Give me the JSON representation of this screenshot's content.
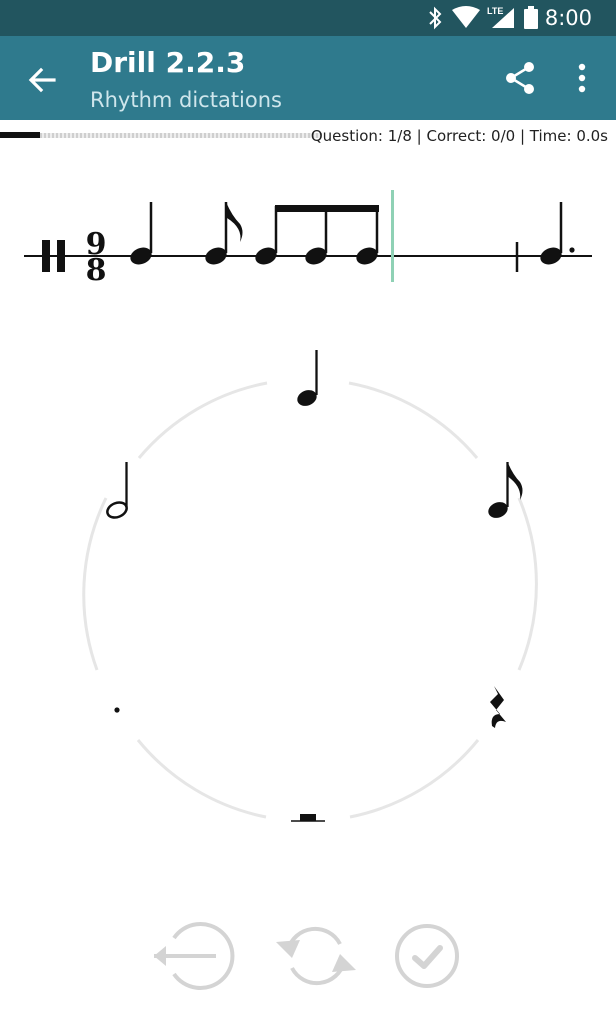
{
  "status_bar": {
    "time": "8:00",
    "network": "LTE",
    "icons": [
      "bluetooth-icon",
      "wifi-icon",
      "signal-icon",
      "battery-icon"
    ]
  },
  "app_bar": {
    "title": "Drill 2.2.3",
    "subtitle": "Rhythm dictations",
    "actions": [
      "share-icon",
      "more-vert-icon"
    ]
  },
  "progress": {
    "fraction": 0.125,
    "stats": "Question: 1/8 | Correct: 0/0 | Time: 0.0s"
  },
  "staff": {
    "time_signature": {
      "numerator": "9",
      "denominator": "8"
    },
    "notes": [
      "quarter",
      "eighth",
      "eighth-beamed",
      "eighth-beamed",
      "eighth-beamed",
      "barline",
      "dotted-quarter"
    ],
    "cursor_color": "#8fd1b5"
  },
  "wheel": {
    "options": [
      "quarter-note",
      "eighth-note",
      "quarter-rest",
      "whole-rest",
      "dot",
      "half-note"
    ]
  },
  "controls": [
    "backspace-icon",
    "replay-icon",
    "check-icon"
  ],
  "colors": {
    "status_bar": "#22555f",
    "app_bar": "#2f7a8d",
    "control_gray": "#d4d4d4"
  }
}
